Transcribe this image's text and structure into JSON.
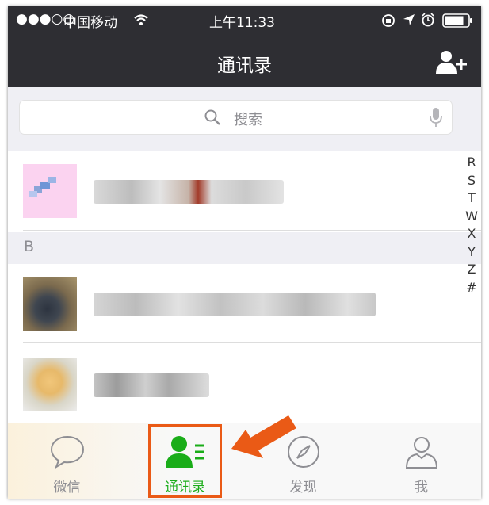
{
  "status_bar": {
    "signal": "●●●○○",
    "carrier": "中国移动",
    "time": "上午11:33"
  },
  "nav": {
    "title": "通讯录",
    "add_contact_icon": "add-contact-icon"
  },
  "search": {
    "placeholder": "搜索",
    "search_icon": "search-icon",
    "mic_icon": "microphone-icon"
  },
  "sections": [
    {
      "letter": "B"
    }
  ],
  "index_letters": [
    "R",
    "S",
    "T",
    "W",
    "X",
    "Y",
    "Z",
    "#"
  ],
  "tabs": [
    {
      "label": "微信",
      "icon": "chat-bubble-icon",
      "active": false
    },
    {
      "label": "通讯录",
      "icon": "contacts-icon",
      "active": true
    },
    {
      "label": "发现",
      "icon": "compass-icon",
      "active": false
    },
    {
      "label": "我",
      "icon": "person-icon",
      "active": false
    }
  ],
  "colors": {
    "accent": "#1aad19",
    "header": "#2e2e33",
    "highlight": "#ea5a16"
  }
}
